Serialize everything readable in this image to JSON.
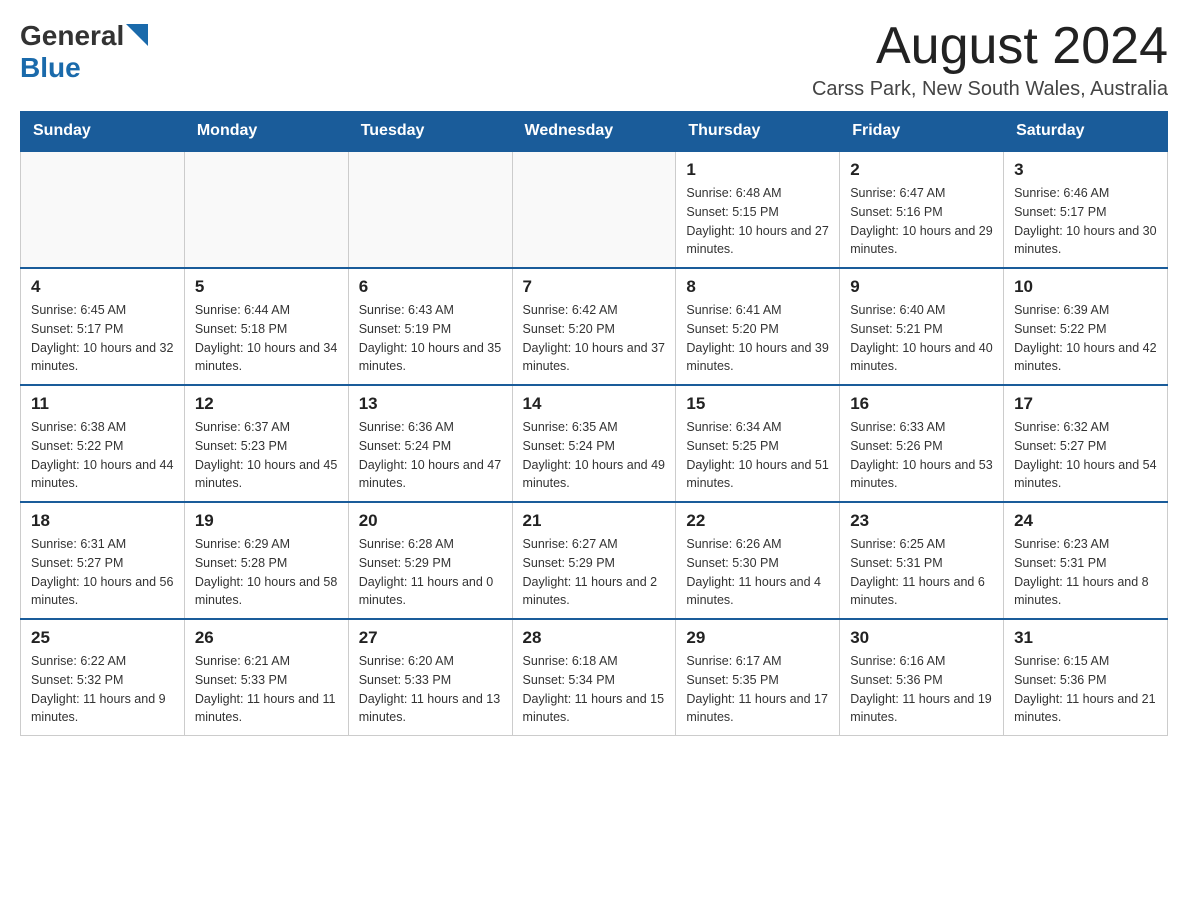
{
  "header": {
    "month_title": "August 2024",
    "location": "Carss Park, New South Wales, Australia",
    "logo_general": "General",
    "logo_blue": "Blue"
  },
  "days_of_week": [
    "Sunday",
    "Monday",
    "Tuesday",
    "Wednesday",
    "Thursday",
    "Friday",
    "Saturday"
  ],
  "weeks": [
    [
      {
        "day": "",
        "info": ""
      },
      {
        "day": "",
        "info": ""
      },
      {
        "day": "",
        "info": ""
      },
      {
        "day": "",
        "info": ""
      },
      {
        "day": "1",
        "info": "Sunrise: 6:48 AM\nSunset: 5:15 PM\nDaylight: 10 hours and 27 minutes."
      },
      {
        "day": "2",
        "info": "Sunrise: 6:47 AM\nSunset: 5:16 PM\nDaylight: 10 hours and 29 minutes."
      },
      {
        "day": "3",
        "info": "Sunrise: 6:46 AM\nSunset: 5:17 PM\nDaylight: 10 hours and 30 minutes."
      }
    ],
    [
      {
        "day": "4",
        "info": "Sunrise: 6:45 AM\nSunset: 5:17 PM\nDaylight: 10 hours and 32 minutes."
      },
      {
        "day": "5",
        "info": "Sunrise: 6:44 AM\nSunset: 5:18 PM\nDaylight: 10 hours and 34 minutes."
      },
      {
        "day": "6",
        "info": "Sunrise: 6:43 AM\nSunset: 5:19 PM\nDaylight: 10 hours and 35 minutes."
      },
      {
        "day": "7",
        "info": "Sunrise: 6:42 AM\nSunset: 5:20 PM\nDaylight: 10 hours and 37 minutes."
      },
      {
        "day": "8",
        "info": "Sunrise: 6:41 AM\nSunset: 5:20 PM\nDaylight: 10 hours and 39 minutes."
      },
      {
        "day": "9",
        "info": "Sunrise: 6:40 AM\nSunset: 5:21 PM\nDaylight: 10 hours and 40 minutes."
      },
      {
        "day": "10",
        "info": "Sunrise: 6:39 AM\nSunset: 5:22 PM\nDaylight: 10 hours and 42 minutes."
      }
    ],
    [
      {
        "day": "11",
        "info": "Sunrise: 6:38 AM\nSunset: 5:22 PM\nDaylight: 10 hours and 44 minutes."
      },
      {
        "day": "12",
        "info": "Sunrise: 6:37 AM\nSunset: 5:23 PM\nDaylight: 10 hours and 45 minutes."
      },
      {
        "day": "13",
        "info": "Sunrise: 6:36 AM\nSunset: 5:24 PM\nDaylight: 10 hours and 47 minutes."
      },
      {
        "day": "14",
        "info": "Sunrise: 6:35 AM\nSunset: 5:24 PM\nDaylight: 10 hours and 49 minutes."
      },
      {
        "day": "15",
        "info": "Sunrise: 6:34 AM\nSunset: 5:25 PM\nDaylight: 10 hours and 51 minutes."
      },
      {
        "day": "16",
        "info": "Sunrise: 6:33 AM\nSunset: 5:26 PM\nDaylight: 10 hours and 53 minutes."
      },
      {
        "day": "17",
        "info": "Sunrise: 6:32 AM\nSunset: 5:27 PM\nDaylight: 10 hours and 54 minutes."
      }
    ],
    [
      {
        "day": "18",
        "info": "Sunrise: 6:31 AM\nSunset: 5:27 PM\nDaylight: 10 hours and 56 minutes."
      },
      {
        "day": "19",
        "info": "Sunrise: 6:29 AM\nSunset: 5:28 PM\nDaylight: 10 hours and 58 minutes."
      },
      {
        "day": "20",
        "info": "Sunrise: 6:28 AM\nSunset: 5:29 PM\nDaylight: 11 hours and 0 minutes."
      },
      {
        "day": "21",
        "info": "Sunrise: 6:27 AM\nSunset: 5:29 PM\nDaylight: 11 hours and 2 minutes."
      },
      {
        "day": "22",
        "info": "Sunrise: 6:26 AM\nSunset: 5:30 PM\nDaylight: 11 hours and 4 minutes."
      },
      {
        "day": "23",
        "info": "Sunrise: 6:25 AM\nSunset: 5:31 PM\nDaylight: 11 hours and 6 minutes."
      },
      {
        "day": "24",
        "info": "Sunrise: 6:23 AM\nSunset: 5:31 PM\nDaylight: 11 hours and 8 minutes."
      }
    ],
    [
      {
        "day": "25",
        "info": "Sunrise: 6:22 AM\nSunset: 5:32 PM\nDaylight: 11 hours and 9 minutes."
      },
      {
        "day": "26",
        "info": "Sunrise: 6:21 AM\nSunset: 5:33 PM\nDaylight: 11 hours and 11 minutes."
      },
      {
        "day": "27",
        "info": "Sunrise: 6:20 AM\nSunset: 5:33 PM\nDaylight: 11 hours and 13 minutes."
      },
      {
        "day": "28",
        "info": "Sunrise: 6:18 AM\nSunset: 5:34 PM\nDaylight: 11 hours and 15 minutes."
      },
      {
        "day": "29",
        "info": "Sunrise: 6:17 AM\nSunset: 5:35 PM\nDaylight: 11 hours and 17 minutes."
      },
      {
        "day": "30",
        "info": "Sunrise: 6:16 AM\nSunset: 5:36 PM\nDaylight: 11 hours and 19 minutes."
      },
      {
        "day": "31",
        "info": "Sunrise: 6:15 AM\nSunset: 5:36 PM\nDaylight: 11 hours and 21 minutes."
      }
    ]
  ]
}
